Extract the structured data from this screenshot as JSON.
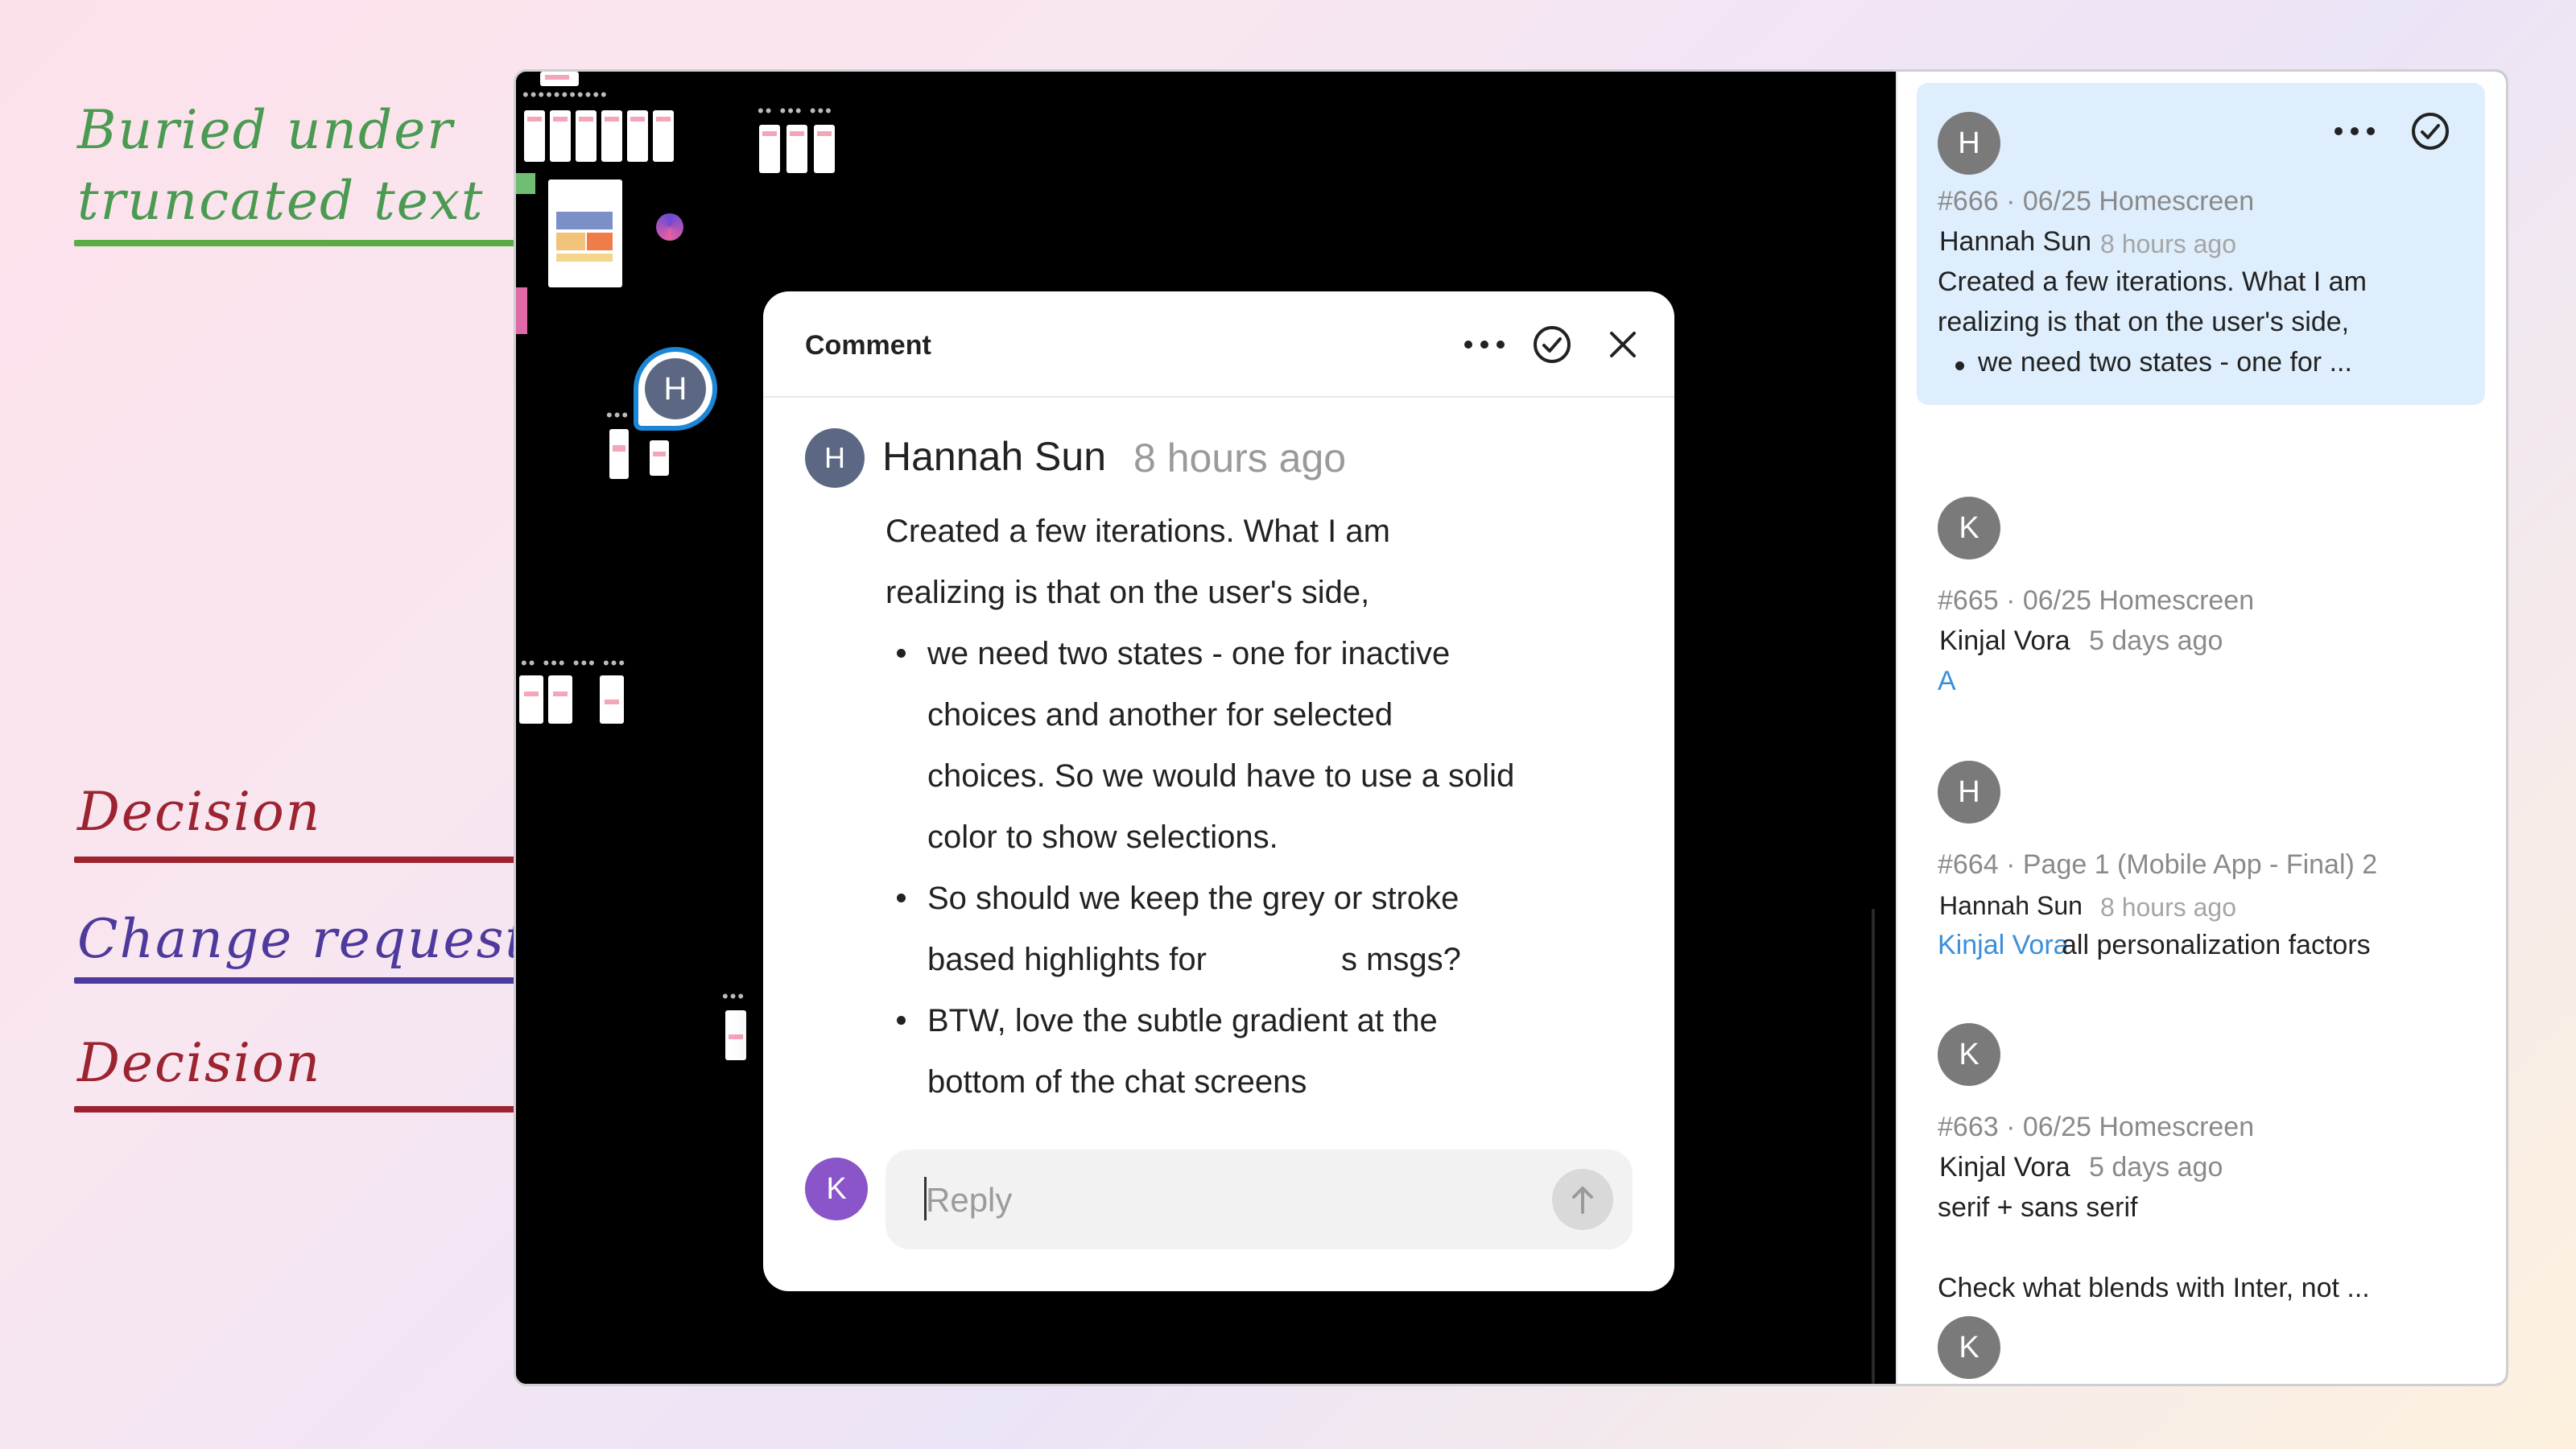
{
  "annotations": {
    "buried": "Buried under\ntruncated text",
    "decision_1": "Decision",
    "change_request": "Change request",
    "decision_2": "Decision"
  },
  "canvas": {
    "pin_initial": "H"
  },
  "dialog": {
    "title": "Comment",
    "author_initial": "H",
    "author_name": "Hannah Sun",
    "author_time": "8 hours ago",
    "para_line_1": "Created a few iterations. What I am",
    "para_line_2": "realizing is that on the user's side,",
    "bullet_1_line_1": "we need two states - one for inactive",
    "bullet_1_line_2": "choices and another for selected",
    "bullet_1_line_3": "choices. So we would have to use a solid",
    "bullet_1_line_4": "color to show selections.",
    "bullet_2_line_1": "So should we keep the grey or stroke",
    "bullet_2_line_2_a": "based highlights for",
    "bullet_2_line_2_b": "s msgs?",
    "bullet_3_line_1": "BTW, love the subtle gradient at the",
    "bullet_3_line_2": "bottom of the chat screens",
    "reply_initial": "K",
    "reply_placeholder": "Reply"
  },
  "sidebar": {
    "items": [
      {
        "initial": "H",
        "title": "#666 · 06/25 Homescreen",
        "author": "Hannah Sun",
        "time": "8 hours ago",
        "line1": "Created a few iterations. What I am",
        "line2": "realizing is that on the user's side,",
        "line3": "we need two states - one for ..."
      },
      {
        "initial": "K",
        "title": "#665 · 06/25 Homescreen",
        "author": "Kinjal Vora",
        "time": "5 days ago",
        "line1": "A"
      },
      {
        "initial": "H",
        "title": "#664 · Page 1 (Mobile App - Final) 2",
        "author": "Hannah Sun",
        "time": "8 hours ago",
        "mention": "Kinjal Vora",
        "line1": "all personalization factors"
      },
      {
        "initial": "K",
        "title": "#663 · 06/25 Homescreen",
        "author": "Kinjal Vora",
        "time": "5 days ago",
        "line1": "serif + sans serif",
        "line2": "Check what blends with Inter, not ..."
      },
      {
        "initial": "K"
      }
    ]
  },
  "colors": {
    "annotation_green": "#5aab45",
    "annotation_red": "#9c2330",
    "annotation_purple": "#4d3aa1",
    "active_comment_bg": "#deeefc",
    "link_blue": "#3b8fd8"
  }
}
